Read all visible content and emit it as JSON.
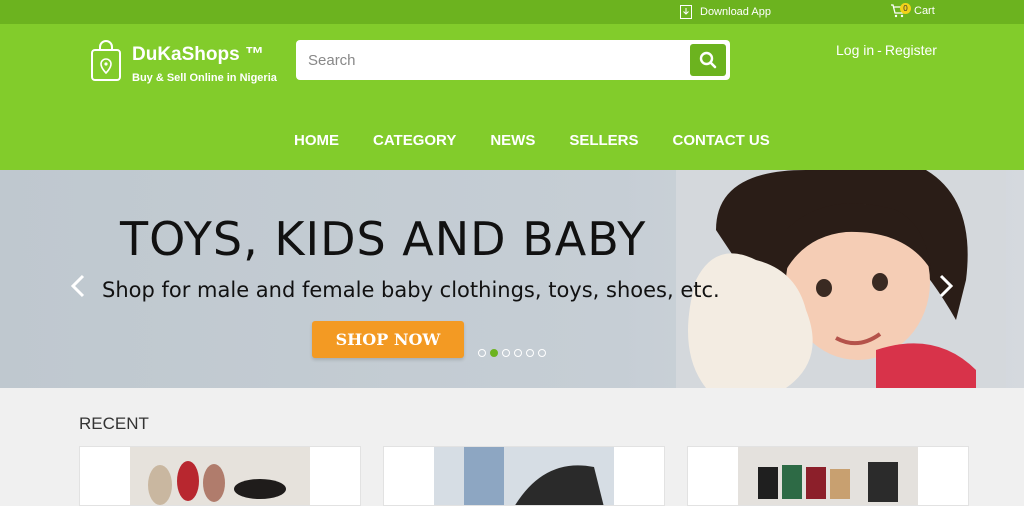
{
  "topbar": {
    "download": "Download App",
    "cart_count": "0",
    "cart": "Cart"
  },
  "brand": {
    "name": "DuKaShops ™",
    "tagline": "Buy & Sell Online in Nigeria"
  },
  "search": {
    "placeholder": "Search"
  },
  "auth": {
    "login": "Log in",
    "separator": "-",
    "register": "Register"
  },
  "nav": [
    "HOME",
    "CATEGORY",
    "NEWS",
    "SELLERS",
    "CONTACT US"
  ],
  "hero": {
    "title": "TOYS, KIDS AND BABY",
    "subtitle": "Shop for male and female baby clothings, toys, shoes, etc.",
    "cta": "SHOP NOW",
    "slides": 6,
    "active_slide": 2
  },
  "section": {
    "title": "RECENT"
  },
  "colors": {
    "topbar": "#6cb31f",
    "header": "#82cc2b",
    "cta": "#f39a23"
  }
}
